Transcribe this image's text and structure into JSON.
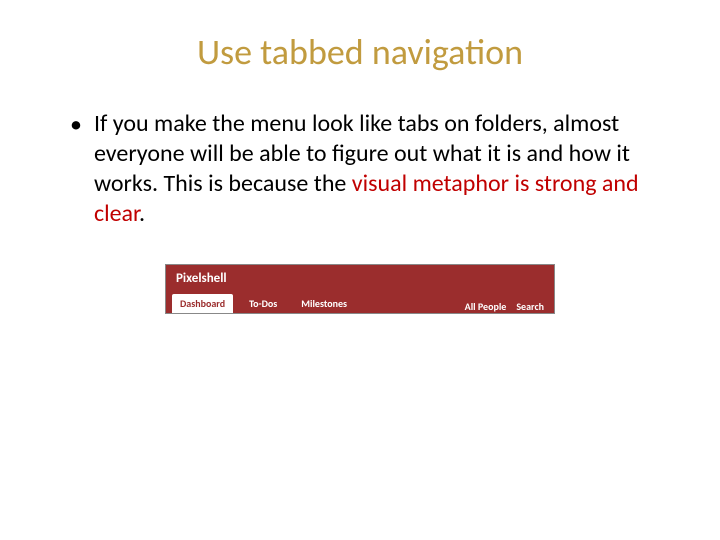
{
  "title": "Use tabbed navigation",
  "bullet": {
    "text_part1": "If you make the menu look like tabs on folders, almost everyone will be able to figure out what it is and how it works. This is because the ",
    "highlight": "visual metaphor is strong and clear",
    "text_part2": "."
  },
  "nav": {
    "brand": "Pixelshell",
    "tabs_left": [
      {
        "label": "Dashboard",
        "active": true
      },
      {
        "label": "To-Dos",
        "active": false
      },
      {
        "label": "Milestones",
        "active": false
      }
    ],
    "tabs_right": [
      {
        "label": "All People"
      },
      {
        "label": "Search"
      }
    ]
  }
}
